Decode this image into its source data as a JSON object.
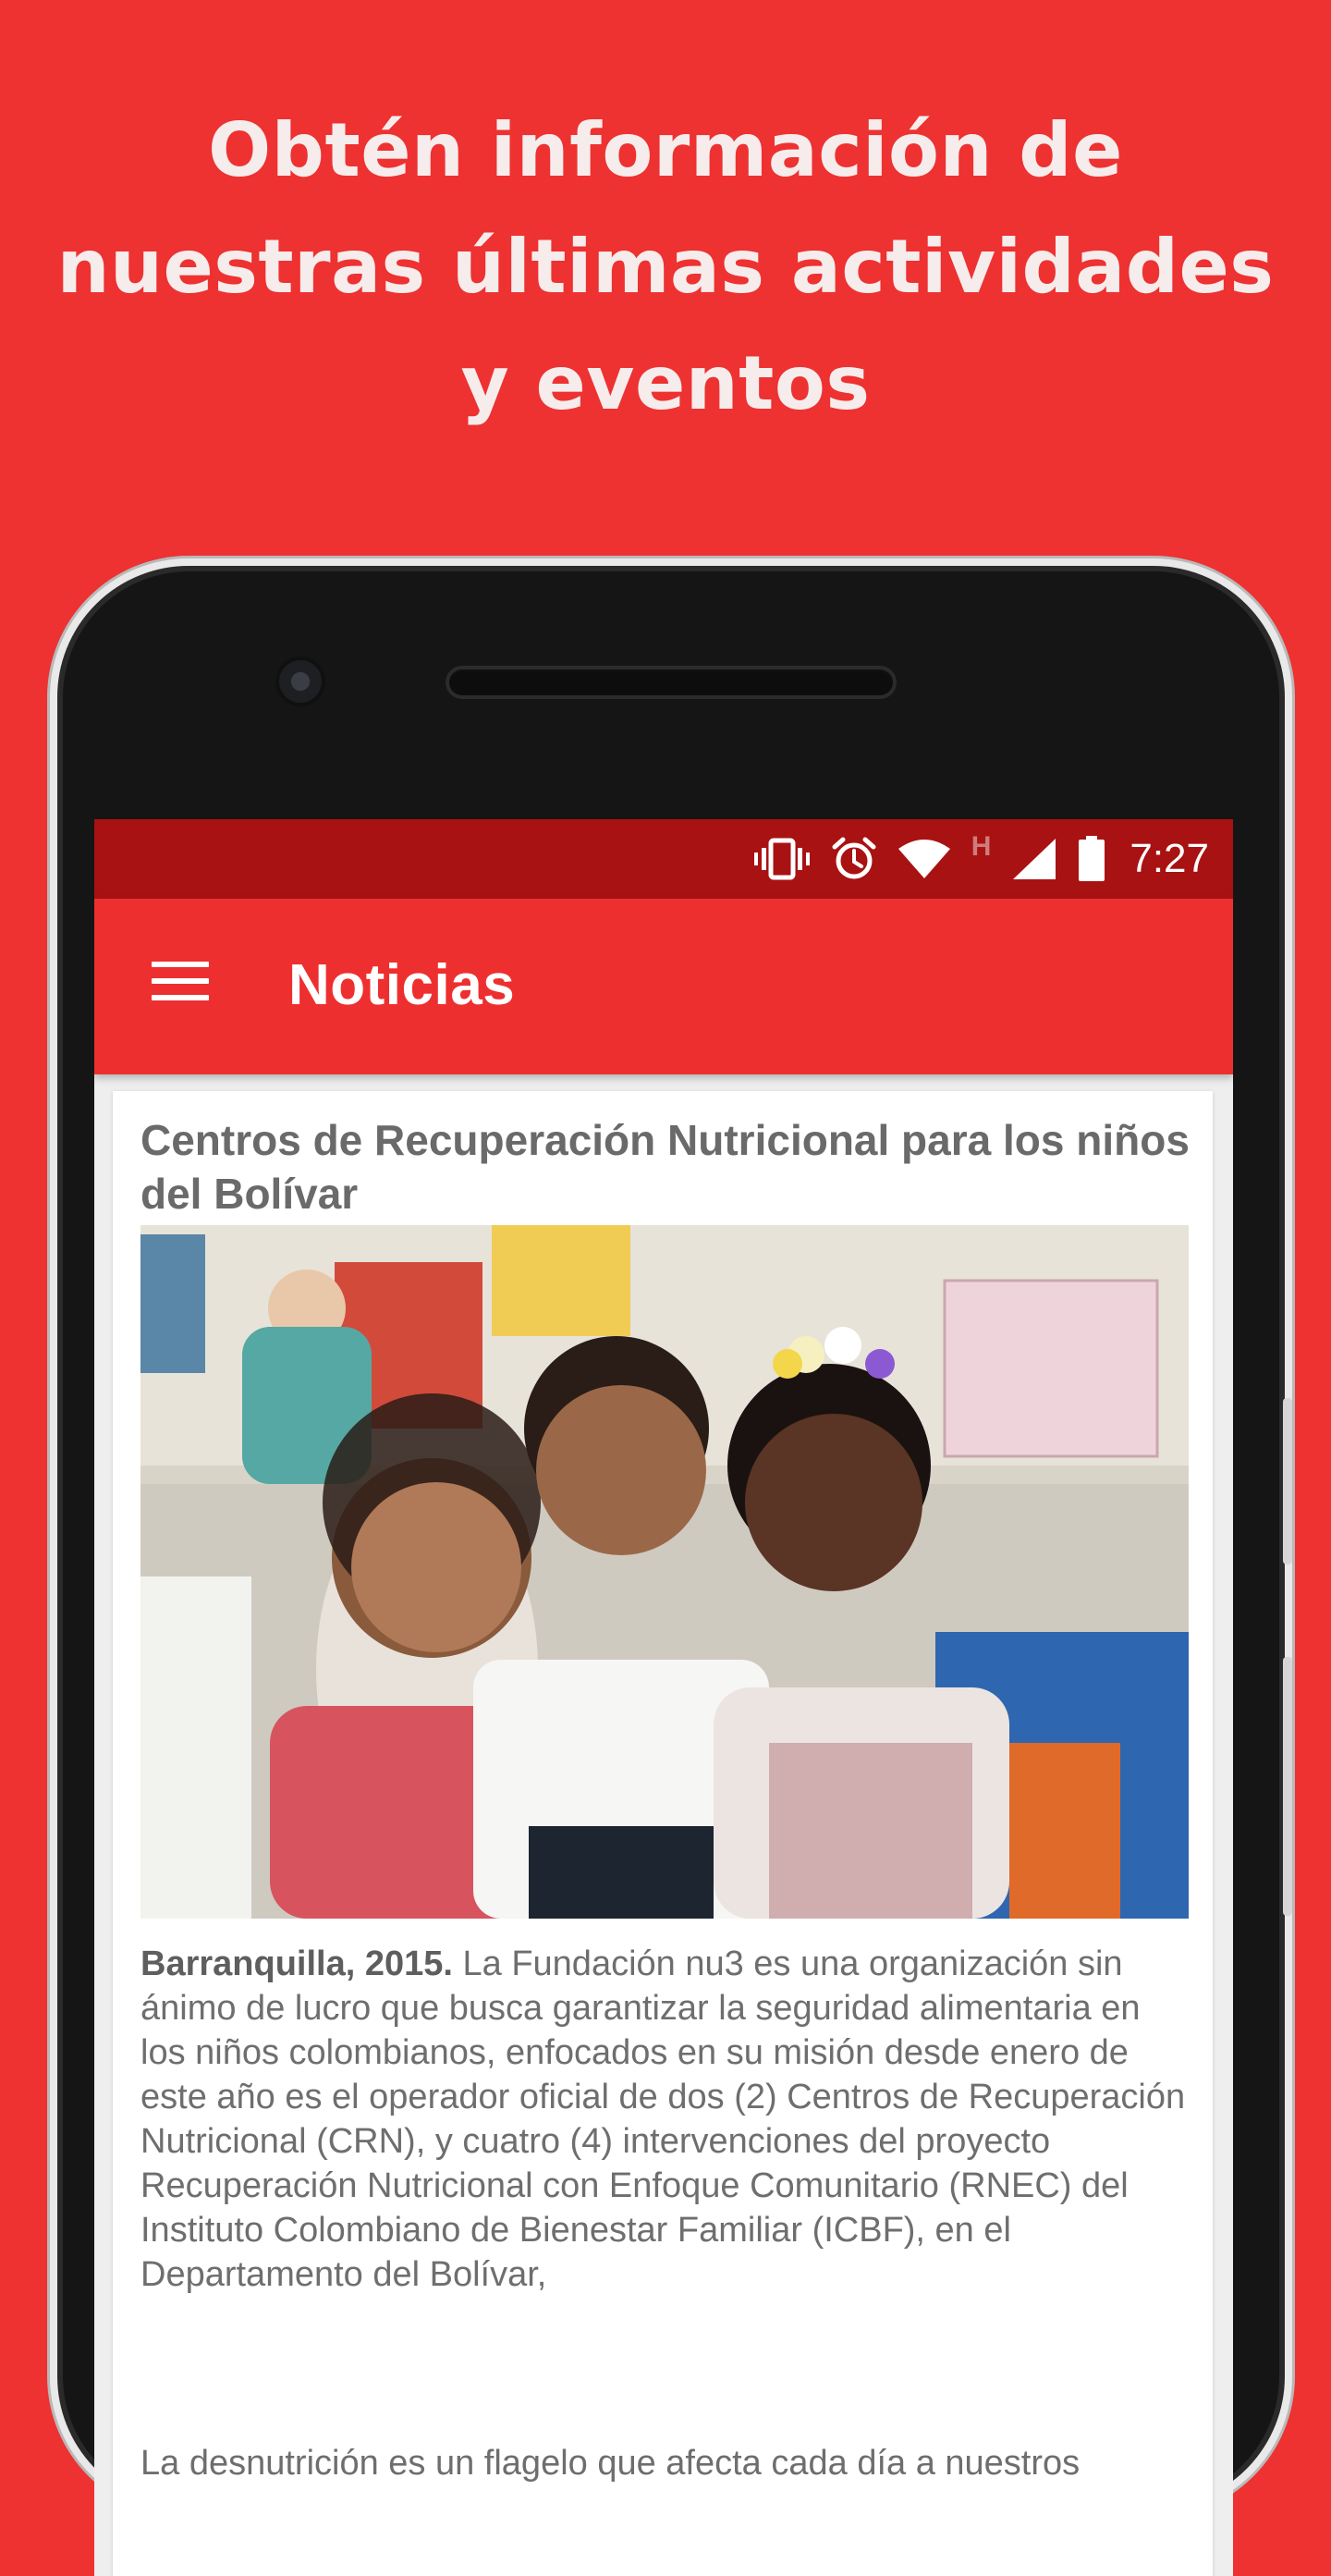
{
  "promo": {
    "heading_line1": "Obtén información de",
    "heading_line2": "nuestras últimas actividades",
    "heading_line3": "y eventos"
  },
  "status_bar": {
    "time": "7:27",
    "network_type": "H",
    "icons": [
      "vibrate-icon",
      "alarm-icon",
      "wifi-icon",
      "signal-icon",
      "battery-icon"
    ]
  },
  "app_bar": {
    "title": "Noticias",
    "menu_icon": "hamburger-menu-icon"
  },
  "article": {
    "title": "Centros de Recuperación Nutricional para los niños del Bolívar",
    "dateline": "Barranquilla, 2015.",
    "paragraph1": "La Fundación nu3 es una organización sin ánimo de lucro que busca garantizar la seguridad alimentaria en los niños colombianos, enfocados en su misión desde enero de este año es el operador oficial de dos (2) Centros de Recuperación Nutricional (CRN), y cuatro (4) intervenciones del proyecto Recuperación Nutricional con Enfoque Comunitario (RNEC) del Instituto Colombiano de Bienestar Familiar (ICBF), en el Departamento del Bolívar,",
    "paragraph2": "La desnutrición es un flagelo que afecta cada día a nuestros"
  },
  "colors": {
    "background": "#ee3131",
    "status_bar": "#a91212",
    "app_bar": "#ee2f2f",
    "heading_text": "#f6ecec"
  }
}
